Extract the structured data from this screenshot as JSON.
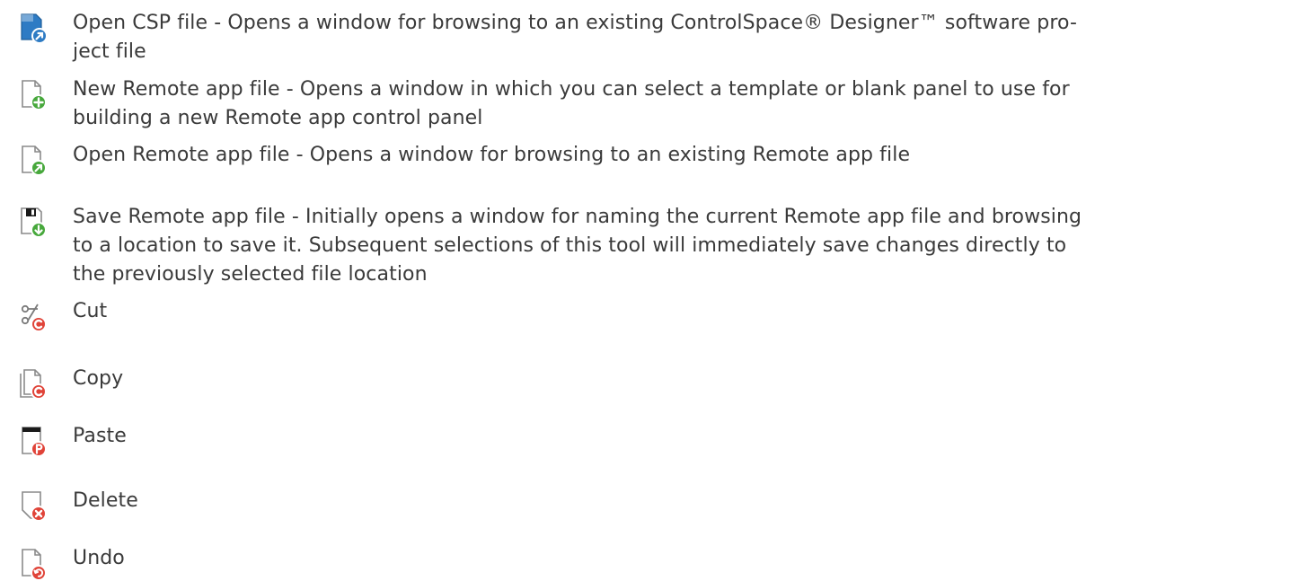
{
  "colors": {
    "text": "#3a3a3a",
    "doc_outline": "#8a8a8a",
    "blue": "#2e7bc4",
    "green": "#47a83c",
    "red": "#e04338",
    "black": "#1a1a1a"
  },
  "items": [
    {
      "icon": "open-csp-icon",
      "text": "Open CSP file - Opens a window for browsing to an existing ControlSpace® Designer™ software pro-\nject file"
    },
    {
      "icon": "new-file-icon",
      "text": "New Remote app file - Opens a window in which you can select a template or blank panel to use for\nbuilding a new Remote app control panel"
    },
    {
      "icon": "open-file-icon",
      "text": "Open Remote app file - Opens a window for browsing to an existing Remote app file"
    },
    {
      "icon": "save-file-icon",
      "text": "Save Remote app file - Initially opens a window for naming the current Remote app file and browsing\nto a location to save it. Subsequent selections of this tool will immediately save changes directly to\nthe previously selected file location"
    },
    {
      "icon": "cut-icon",
      "text": "Cut"
    },
    {
      "icon": "copy-icon",
      "text": "Copy"
    },
    {
      "icon": "paste-icon",
      "text": "Paste"
    },
    {
      "icon": "delete-icon",
      "text": "Delete"
    },
    {
      "icon": "undo-icon",
      "text": "Undo"
    }
  ]
}
